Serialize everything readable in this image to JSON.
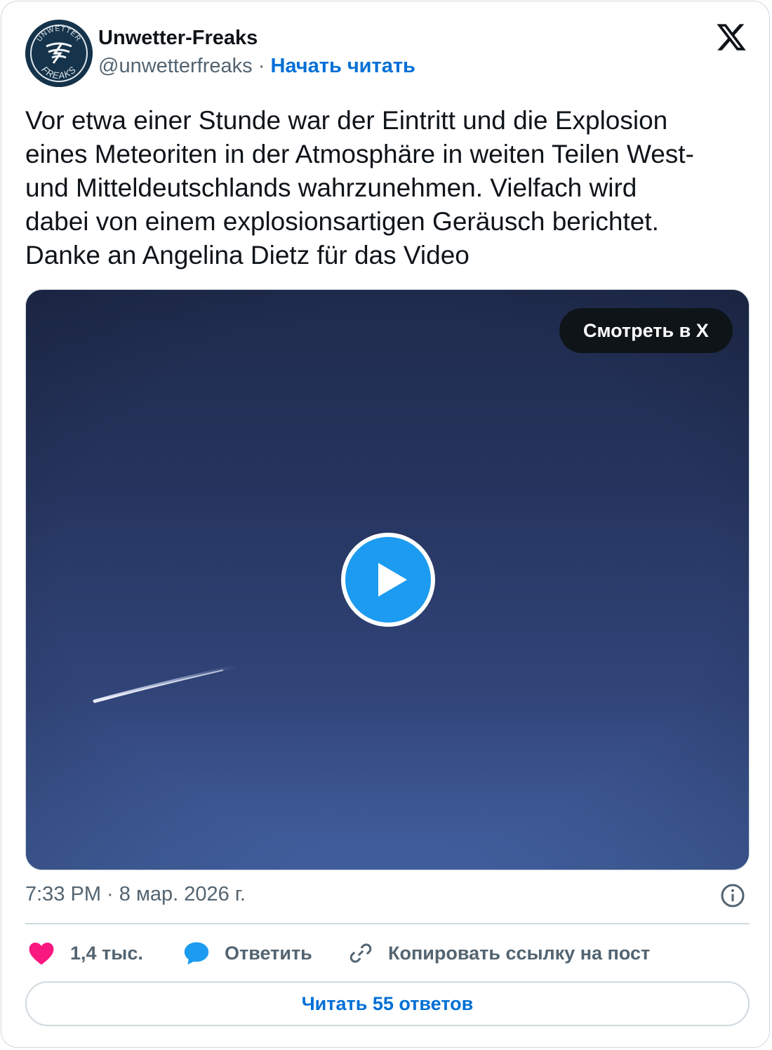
{
  "author": {
    "name": "Unwetter-Freaks",
    "handle": "@unwetterfreaks",
    "separator": "·",
    "follow_label": "Начать читать",
    "avatar_text_top": "UNWETTER",
    "avatar_text_bottom": "FREAKS"
  },
  "tweet": {
    "text": "Vor etwa einer Stunde war der Eintritt und die Explosion\neines Meteoriten in der Atmosphäre in weiten Teilen West-\nund Mitteldeutschlands wahrzunehmen. Vielfach wird\ndabei von einem explosionsartigen Geräusch berichtet.\nDanke an Angelina Dietz für das Video"
  },
  "media": {
    "watch_label": "Смотреть в X"
  },
  "meta": {
    "timestamp": "7:33 PM · 8 мар. 2026 г."
  },
  "actions": {
    "likes_count": "1,4 тыс.",
    "reply_label": "Ответить",
    "copy_link_label": "Копировать ссылку на пост"
  },
  "footer": {
    "read_replies_label": "Читать 55 ответов"
  },
  "colors": {
    "accent": "#1d9bf0",
    "link": "#006fd6",
    "like": "#f91880",
    "muted": "#536471"
  }
}
